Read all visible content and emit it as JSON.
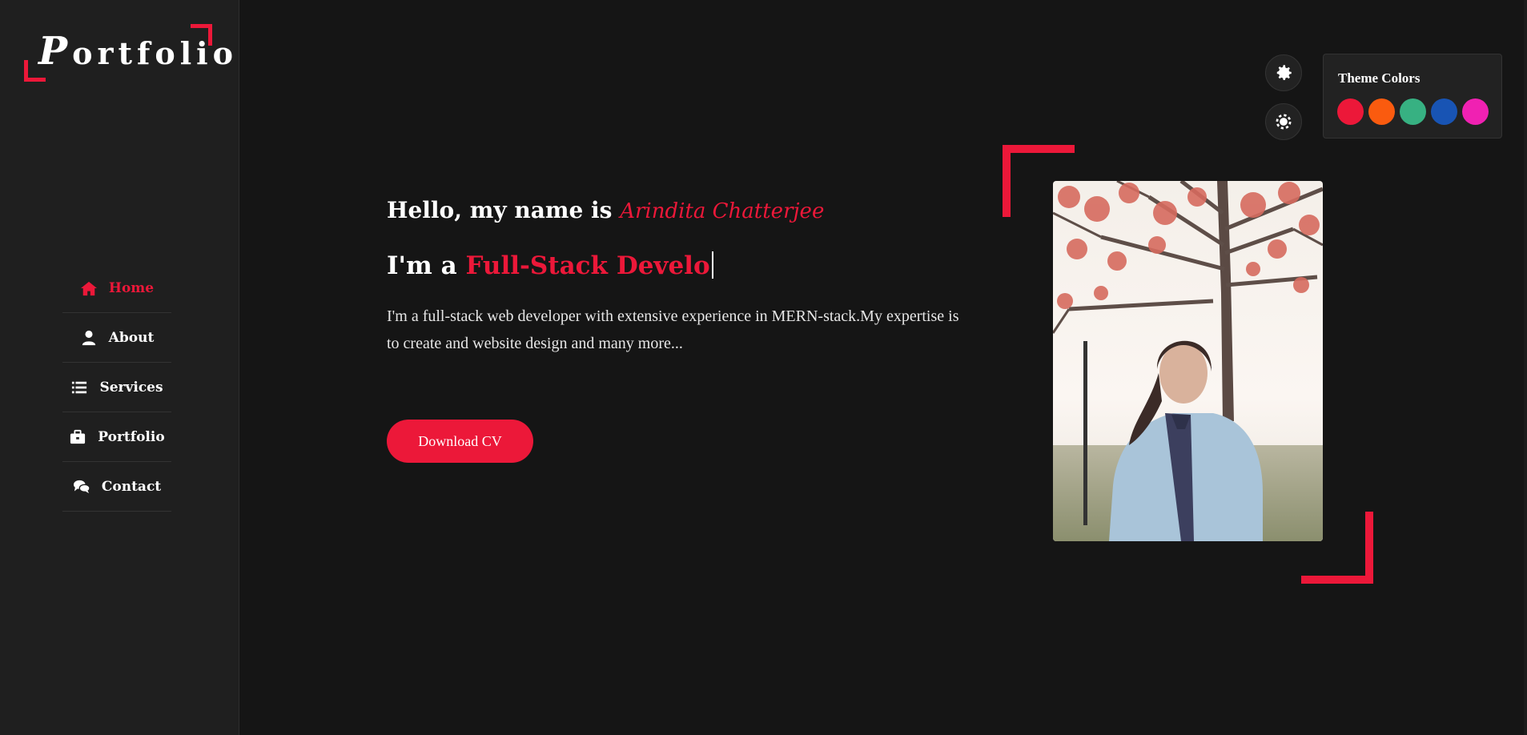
{
  "logo": {
    "first_letter": "P",
    "rest": "ortfolio"
  },
  "nav": {
    "items": [
      {
        "label": "Home",
        "icon": "home-icon",
        "active": true
      },
      {
        "label": "About",
        "icon": "user-icon",
        "active": false
      },
      {
        "label": "Services",
        "icon": "list-icon",
        "active": false
      },
      {
        "label": "Portfolio",
        "icon": "briefcase-icon",
        "active": false
      },
      {
        "label": "Contact",
        "icon": "comments-icon",
        "active": false
      }
    ]
  },
  "hero": {
    "greeting": "Hello, my name is ",
    "name": "Arindita Chatterjee",
    "role_prefix": "I'm a ",
    "role_typed": "Full-Stack Develo",
    "description": "I'm a full-stack web developer with extensive experience in MERN-stack.My expertise is to create and website design and many more...",
    "cta_label": "Download CV"
  },
  "settings": {
    "theme_title": "Theme Colors",
    "swatches": [
      "#ec1839",
      "#fa5b0f",
      "#37b182",
      "#1854b4",
      "#f021b2"
    ]
  },
  "colors": {
    "accent": "#ec1839",
    "background": "#151515",
    "sidebar": "#1f1f1f"
  }
}
